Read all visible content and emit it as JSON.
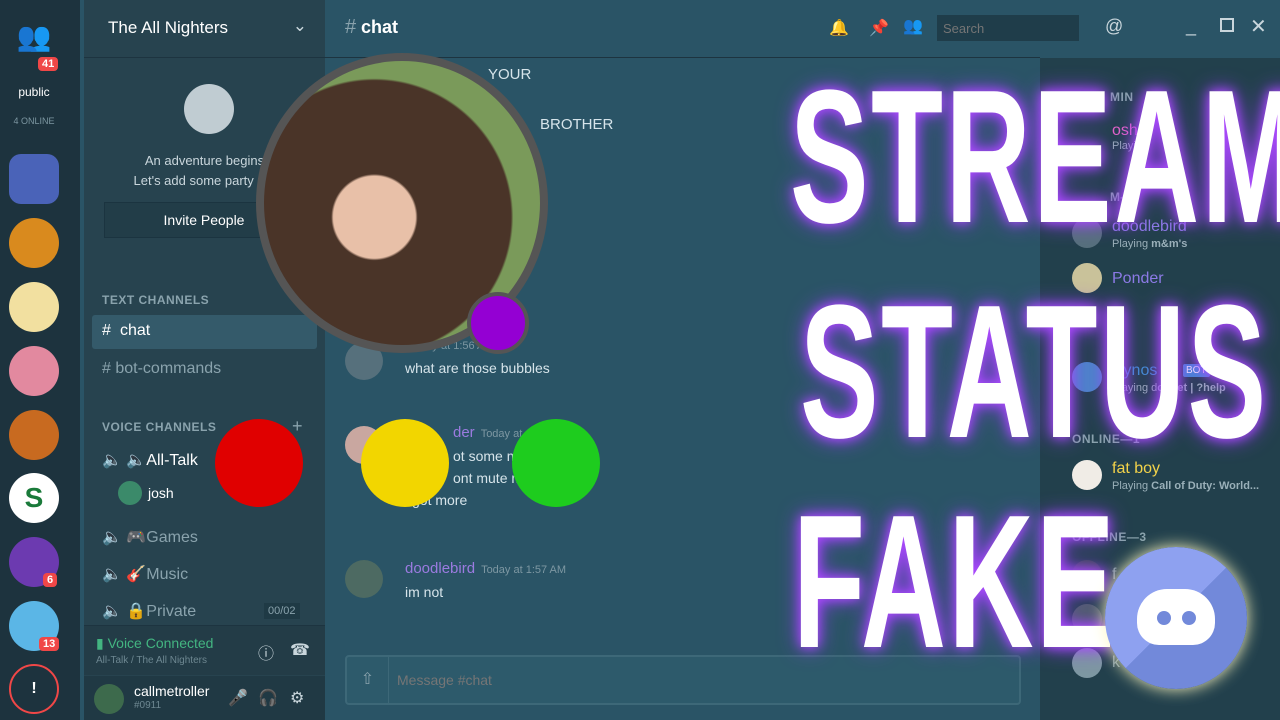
{
  "servers": {
    "top_badge": "41",
    "public_label": "public",
    "online": "4 ONLINE",
    "badges": [
      "6",
      "13"
    ],
    "alert": "!"
  },
  "channels": {
    "server_name": "The All Nighters",
    "invite": {
      "line1": "An adventure begins",
      "line2": "Let's add some party me",
      "button": "Invite People"
    },
    "text_header": "TEXT CHANNELS",
    "text": [
      "chat",
      "bot-commands"
    ],
    "voice_header": "VOICE CHANNELS",
    "voice": [
      "🔈All-Talk",
      "🎮Games",
      "🎸Music",
      "🔒Private"
    ],
    "voice_user": "josh",
    "private_count": "00/02",
    "voice_status": "Voice Connected",
    "voice_location": "All-Talk / The All Nighters",
    "user": {
      "name": "callmetroller",
      "tag": "#0911"
    }
  },
  "chat": {
    "channel": "chat",
    "search_placeholder": "Search",
    "input_placeholder": "Message #chat",
    "fragments": [
      "YOUR",
      "BROTHER"
    ],
    "messages": [
      {
        "author": "",
        "time": "today at 1:56 AM",
        "lines": [
          "what are those bubbles"
        ]
      },
      {
        "author": "der",
        "time": "Today at 1:56",
        "lines": [
          "ot some m",
          "ont mute m",
          "i got more"
        ]
      },
      {
        "author": "doodlebird",
        "time": "Today at 1:57 AM",
        "lines": [
          "im not"
        ]
      }
    ]
  },
  "members": {
    "admin_header": "MIN",
    "admin": {
      "name": "osh",
      "activity": "Playing"
    },
    "mod_header": "M—",
    "mods": [
      {
        "name": "doodlebird",
        "activity": "Playing ",
        "game": "m&m's"
      },
      {
        "name": "Ponder",
        "activity": "",
        "game": ""
      }
    ],
    "bot_header": "T",
    "bot": {
      "name": "Dynos",
      "badge": "BOT",
      "activity": "Playing d",
      "game": "ot.net | ?help"
    },
    "online_header": "ONLINE—1",
    "online": {
      "name": "fat boy",
      "activity": "Playing ",
      "game": "Call of Duty: World..."
    },
    "offline_header": "OFFLINE—3",
    "offline": [
      "f",
      "",
      "k"
    ]
  },
  "overlay": {
    "lines": [
      "STREAM",
      "STATUS",
      "FAKE"
    ]
  },
  "colors": {
    "purple": "#9400d3",
    "red": "#e00000",
    "yellow": "#f2d600",
    "green": "#1ecc1e",
    "discord": "#7289da"
  }
}
